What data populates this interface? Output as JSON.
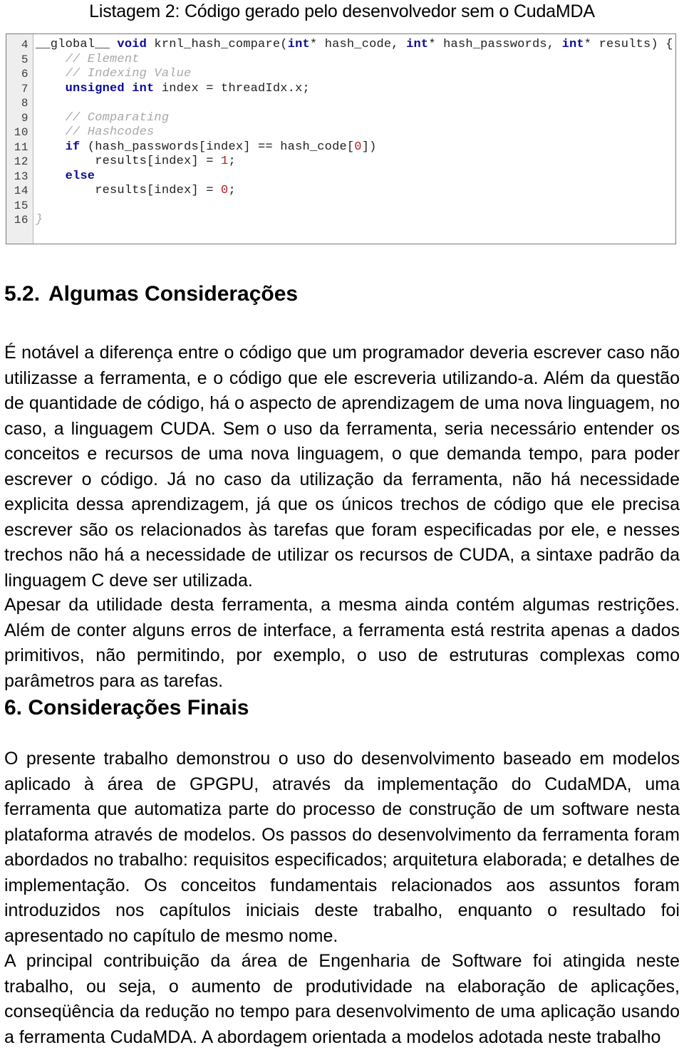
{
  "caption": {
    "text": "Listagem 2: Código gerado pelo desenvolvedor sem o CudaMDA"
  },
  "code_listing": {
    "line_numbers": [
      "4",
      "5",
      "6",
      "7",
      "8",
      "9",
      "10",
      "11",
      "12",
      "13",
      "14",
      "15",
      "16"
    ],
    "lines": [
      "__global__ void krnl_hash_compare(int* hash_code, int* hash_passwords, int* results) {",
      "    // Element",
      "    // Indexing Value",
      "    unsigned int index = threadIdx.x;",
      "",
      "    // Comparating",
      "    // Hashcodes",
      "    if (hash_passwords[index] == hash_code[0])",
      "        results[index] = 1;",
      "    else",
      "        results[index] = 0;",
      "",
      "}"
    ],
    "tokens": {
      "l4_a": "__global__ ",
      "l4_kw1": "void",
      "l4_b": " krnl_hash_compare(",
      "l4_kw2": "int",
      "l4_c": "* hash_code, ",
      "l4_kw3": "int",
      "l4_d": "* hash_passwords, ",
      "l4_kw4": "int",
      "l4_e": "* results) {",
      "l5": "    // Element",
      "l6": "    // Indexing Value",
      "l7_kw": "    unsigned int",
      "l7_rest": " index = threadIdx.x;",
      "l8": "",
      "l9": "    // Comparating",
      "l10": "    // Hashcodes",
      "l11_kw": "    if",
      "l11_a": " (hash_passwords[index] == hash_code[",
      "l11_num": "0",
      "l11_b": "])",
      "l12_a": "        results[index] = ",
      "l12_num": "1",
      "l12_b": ";",
      "l13_kw": "    else",
      "l14_a": "        results[index] = ",
      "l14_num": "0",
      "l14_b": ";",
      "l15": "",
      "l16": "}"
    },
    "colors": {
      "keyword": "#0b0b9c",
      "comment": "#a8a8a8",
      "number": "#b02020",
      "plain": "#1f1f1f",
      "gutter_bg": "#eeeeee",
      "border": "#7a7a7a"
    }
  },
  "headings": {
    "section_52_number": "5.2.",
    "section_52_title": "Algumas Considerações",
    "section_6": "6. Considerações Finais"
  },
  "paragraphs": {
    "p1": "É notável a diferença entre o código que um programador deveria escrever caso não utilizasse a ferramenta, e o código que ele escreveria utilizando-a. Além da questão de quantidade de código, há o aspecto de aprendizagem de uma nova linguagem, no caso, a linguagem CUDA. Sem o uso da ferramenta, seria necessário entender os conceitos e recursos de uma nova linguagem, o que demanda tempo, para poder escrever o código. Já no caso da utilização da ferramenta, não há necessidade explicita dessa aprendizagem, já que os únicos trechos de código que ele precisa escrever são os relacionados às tarefas que foram especificadas por ele, e nesses trechos não há a necessidade de utilizar os recursos de CUDA, a sintaxe padrão da linguagem C deve ser utilizada.",
    "p2": "Apesar da utilidade desta ferramenta, a mesma ainda contém algumas restrições. Além de conter alguns erros de interface, a ferramenta está restrita apenas a dados primitivos, não permitindo, por exemplo, o uso de estruturas complexas como parâmetros para as tarefas.",
    "p3": "O presente trabalho demonstrou o uso do desenvolvimento baseado em modelos aplicado à área de GPGPU, através da implementação do CudaMDA, uma ferramenta que automatiza parte do processo de construção de um software nesta plataforma através de modelos. Os passos do desenvolvimento da ferramenta foram abordados no trabalho: requisitos especificados; arquitetura elaborada; e detalhes de implementação. Os conceitos fundamentais relacionados aos assuntos foram introduzidos nos capítulos iniciais deste trabalho, enquanto o resultado foi apresentado no capítulo de mesmo nome.",
    "p4": "A principal contribuição da área de Engenharia de Software foi atingida neste trabalho, ou seja, o aumento de produtividade na elaboração de aplicações, conseqüência da redução no tempo para desenvolvimento de uma aplicação usando a ferramenta CudaMDA. A abordagem orientada a modelos adotada neste trabalho"
  }
}
